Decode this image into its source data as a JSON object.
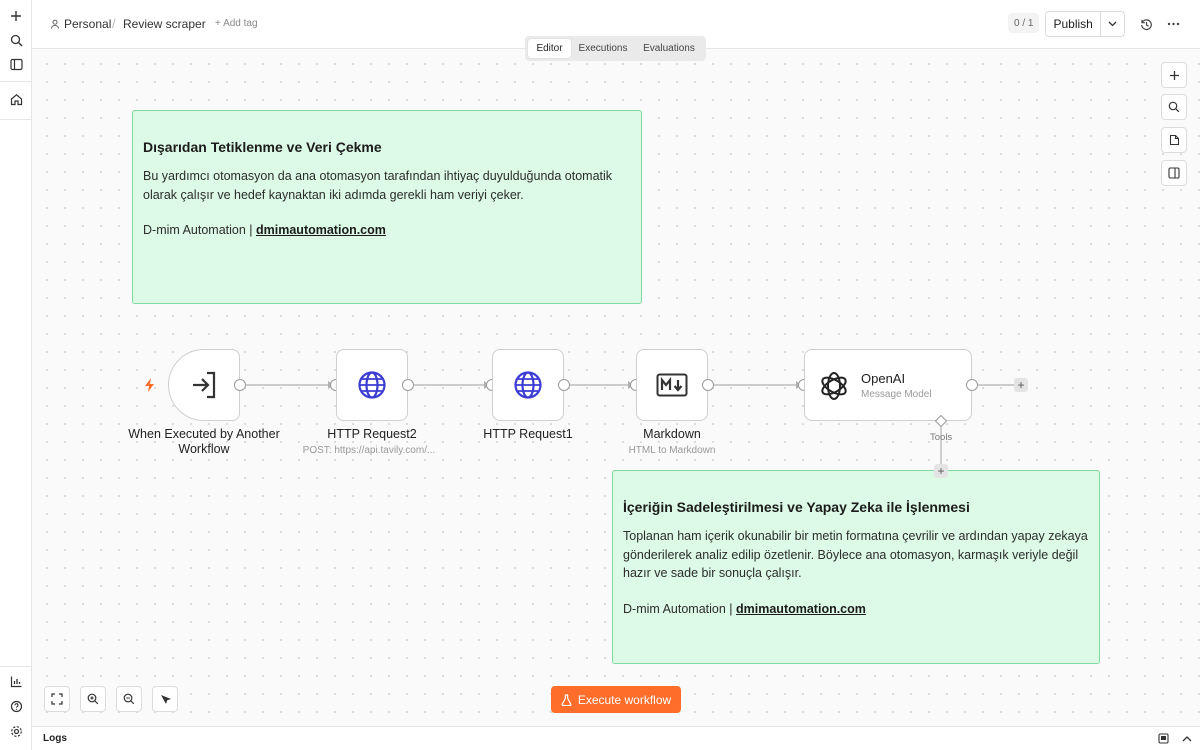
{
  "breadcrumb": {
    "workspace": "Personal",
    "separator": "/",
    "workflow_name": "Review scraper",
    "add_tag": "+ Add tag"
  },
  "header": {
    "version_counter": "0 / 1",
    "publish_label": "Publish"
  },
  "tabs": [
    {
      "label": "Editor",
      "active": true
    },
    {
      "label": "Executions",
      "active": false
    },
    {
      "label": "Evaluations",
      "active": false
    }
  ],
  "sticky_notes": [
    {
      "title": "Dışarıdan Tetiklenme ve Veri Çekme",
      "body": "Bu yardımcı otomasyon da ana otomasyon tarafından ihtiyaç duyulduğunda otomatik olarak çalışır ve hedef kaynaktan iki adımda gerekli ham veriyi çeker.",
      "credit_prefix": "D-mim Automation | ",
      "credit_link": "dmimautomation.com"
    },
    {
      "title": "İçeriğin Sadeleştirilmesi ve Yapay Zeka ile İşlenmesi",
      "body": "Toplanan ham içerik okunabilir bir metin formatına çevrilir ve ardından yapay zekaya gönderilerek analiz edilip özetlenir. Böylece ana otomasyon, karmaşık veriyle değil hazır ve sade bir sonuçla çalışır.",
      "credit_prefix": "D-mim Automation | ",
      "credit_link": "dmimautomation.com"
    }
  ],
  "nodes": [
    {
      "name": "When Executed by Another Workflow",
      "subtitle": "",
      "icon": "execute-workflow-trigger-icon"
    },
    {
      "name": "HTTP Request2",
      "subtitle": "POST: https://api.tavily.com/...",
      "icon": "globe-icon"
    },
    {
      "name": "HTTP Request1",
      "subtitle": "",
      "icon": "globe-icon"
    },
    {
      "name": "Markdown",
      "subtitle": "HTML to Markdown",
      "icon": "markdown-icon"
    },
    {
      "name": "OpenAI",
      "subtitle": "Message Model",
      "icon": "openai-icon"
    }
  ],
  "tools_label": "Tools",
  "execute_label": "Execute workflow",
  "logs_label": "Logs",
  "colors": {
    "accent": "#ff6d2b",
    "sticky_bg": "#dcfae6",
    "sticky_border": "#7ed8a0",
    "node_icon": "#3b3bd4"
  }
}
